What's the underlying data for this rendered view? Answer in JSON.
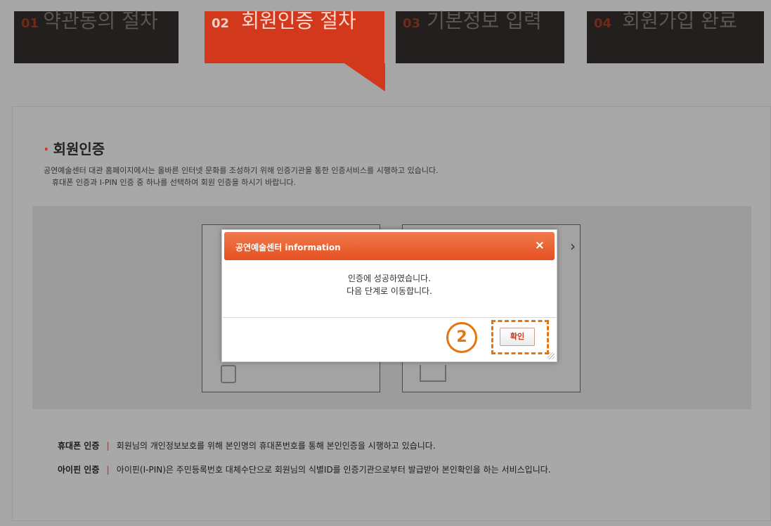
{
  "steps": [
    {
      "num": "01",
      "label": "약관동의 절차",
      "active": false
    },
    {
      "num": "02",
      "label": "회원인증 절차",
      "active": true
    },
    {
      "num": "03",
      "label": "기본정보 입력",
      "active": false
    },
    {
      "num": "04",
      "label": "회원가입 완료",
      "active": false
    }
  ],
  "section": {
    "title": "회원인증",
    "desc_line1": "공연예술센터 대관 홈페이지에서는 올바른 인터넷 문화를 조성하기 위해 인증기관을 통한 인증서비스를 시행하고 있습니다.",
    "desc_line2": "휴대폰 인증과 I-PIN 인증 중 하나를 선택하여 회원 인증을 하시기 바랍니다."
  },
  "footer": {
    "phone_key": "휴대폰 인증",
    "phone_sep": "|",
    "phone_text": "회원님의 개인정보보호를 위해 본인명의 휴대폰번호를 통해 본인인증을 시행하고 있습니다.",
    "ipin_key": "아이핀 인증",
    "ipin_sep": "|",
    "ipin_text": "아이핀(I-PIN)은 주민등록번호 대체수단으로 회원님의 식별ID를 인증기관으로부터 발급받아 본인확인을 하는 서비스입니다."
  },
  "modal": {
    "title": "공연예술센터 information",
    "close": "×",
    "msg_line1": "인증에 성공하였습니다.",
    "msg_line2": "다음 단계로 이동합니다.",
    "confirm_label": "확인"
  },
  "annotation": {
    "step_number": "2"
  },
  "colors": {
    "accent": "#d2381c",
    "annotation": "#e8720c",
    "inactive_step": "#231f1e"
  }
}
